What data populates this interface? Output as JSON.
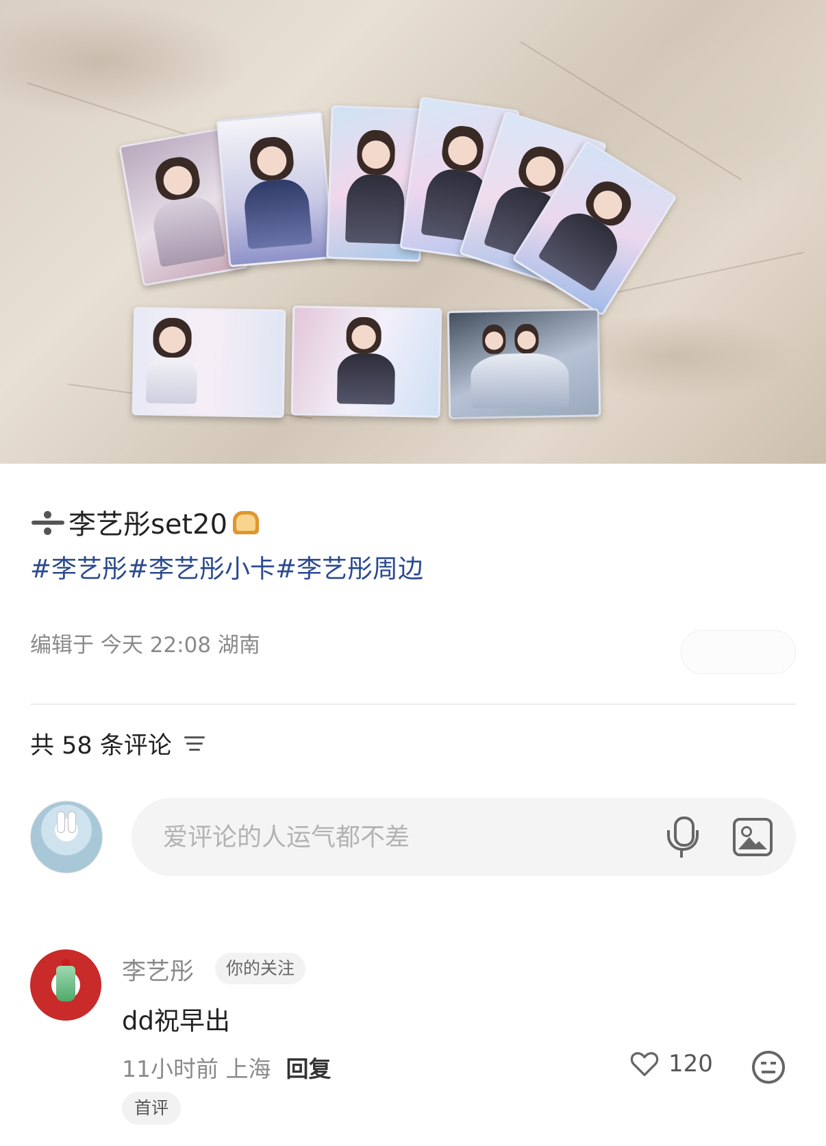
{
  "post": {
    "title": "李艺彤set20",
    "tags": "#李艺彤#李艺彤小卡#李艺彤周边",
    "meta": "编辑于 今天 22:08 湖南"
  },
  "comments_section": {
    "count_label": "共 58 条评论",
    "input_placeholder": "爱评论的人运气都不差"
  },
  "comment": {
    "author": "李艺彤",
    "badge": "你的关注",
    "text": "dd祝早出",
    "time_location": "11小时前 上海",
    "reply_label": "回复",
    "likes": "120",
    "first_badge": "首评"
  },
  "icons": [
    "divide-icon",
    "bread-icon",
    "sort-icon",
    "mic-icon",
    "image-icon",
    "heart-icon",
    "emoji-icon"
  ],
  "colors": {
    "tag_link": "#2b4a8f",
    "secondary_text": "#8a8a8a",
    "input_bg": "#f4f4f4"
  }
}
